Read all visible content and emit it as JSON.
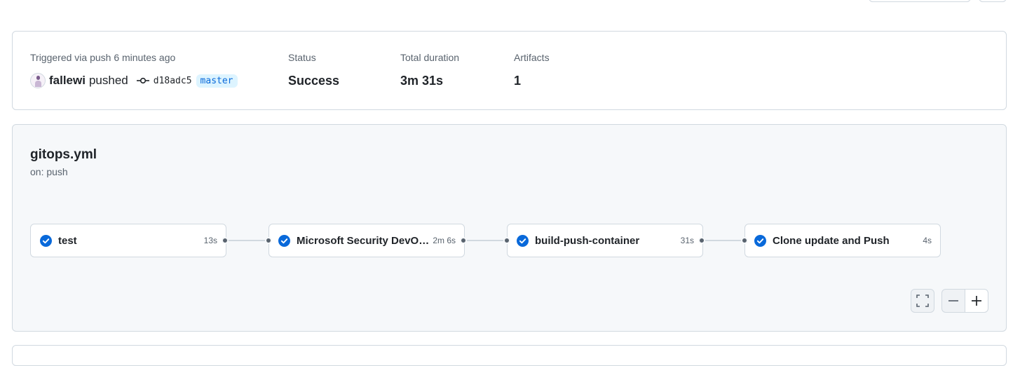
{
  "summary": {
    "trigger_label": "Triggered via push 6 minutes ago",
    "actor": "fallewi",
    "action": "pushed",
    "commit_sha": "d18adc5",
    "branch": "master",
    "status_label": "Status",
    "status_value": "Success",
    "duration_label": "Total duration",
    "duration_value": "3m 31s",
    "artifacts_label": "Artifacts",
    "artifacts_value": "1"
  },
  "workflow": {
    "file": "gitops.yml",
    "trigger": "on: push",
    "jobs": [
      {
        "name": "test",
        "duration": "13s",
        "status": "success"
      },
      {
        "name": "Microsoft Security DevOps",
        "duration": "2m 6s",
        "status": "success"
      },
      {
        "name": "build-push-container",
        "duration": "31s",
        "status": "success"
      },
      {
        "name": "Clone update and Push",
        "duration": "4s",
        "status": "success"
      }
    ]
  },
  "controls": {
    "fullscreen_icon": "fullscreen-icon",
    "zoom_out_icon": "minus-icon",
    "zoom_in_icon": "plus-icon"
  },
  "colors": {
    "success": "#0969da",
    "branch_bg": "#ddf4ff"
  }
}
